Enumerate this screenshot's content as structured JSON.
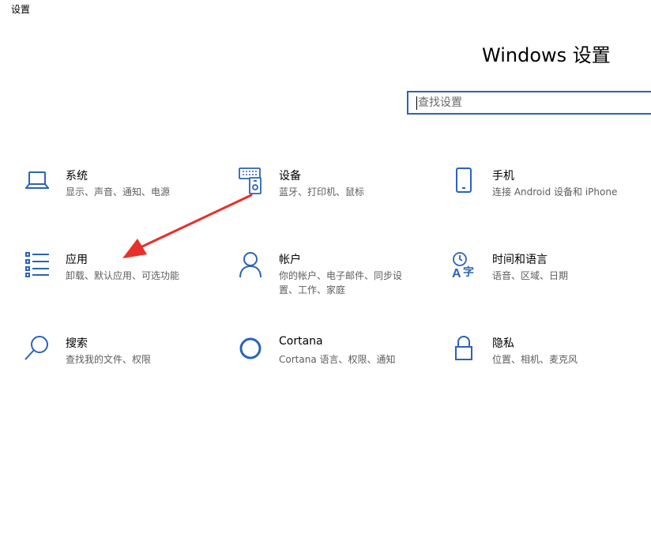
{
  "window": {
    "title": "设置"
  },
  "header": {
    "title": "Windows 设置"
  },
  "search": {
    "placeholder": "查找设置"
  },
  "tiles": [
    {
      "title": "系统",
      "desc": "显示、声音、通知、电源",
      "icon": "laptop-icon"
    },
    {
      "title": "设备",
      "desc": "蓝牙、打印机、鼠标",
      "icon": "devices-icon"
    },
    {
      "title": "手机",
      "desc": "连接 Android 设备和 iPhone",
      "icon": "phone-icon"
    },
    {
      "title": "应用",
      "desc": "卸载、默认应用、可选功能",
      "icon": "apps-list-icon"
    },
    {
      "title": "帐户",
      "desc": "你的帐户、电子邮件、同步设置、工作、家庭",
      "icon": "person-icon"
    },
    {
      "title": "时间和语言",
      "desc": "语音、区域、日期",
      "icon": "time-language-icon"
    },
    {
      "title": "搜索",
      "desc": "查找我的文件、权限",
      "icon": "search-icon"
    },
    {
      "title": "Cortana",
      "desc": "Cortana 语言、权限、通知",
      "icon": "cortana-icon"
    },
    {
      "title": "隐私",
      "desc": "位置、相机、麦克风",
      "icon": "lock-icon"
    }
  ],
  "colors": {
    "accent": "#2b63b8",
    "icon": "#2b63b8",
    "annotation_arrow": "#e8302a",
    "subtext": "#5d5d5d"
  }
}
